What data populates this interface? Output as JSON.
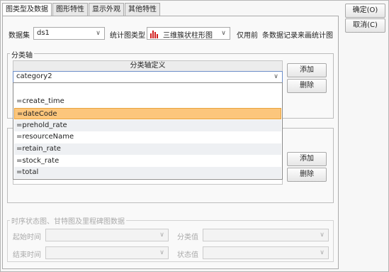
{
  "tabs": [
    "图类型及数据",
    "图形特性",
    "显示外观",
    "其他特性"
  ],
  "buttons": {
    "ok": "确定(O)",
    "cancel": "取消(C)",
    "add1": "添加",
    "delete1": "删除",
    "add2": "添加",
    "delete2": "删除"
  },
  "dataset": {
    "label": "数据集",
    "value": "ds1"
  },
  "chart_type": {
    "label": "统计图类型",
    "value": "三维簇状柱形图",
    "icon": "bar-chart-icon"
  },
  "limit": {
    "prefix": "仅用前",
    "suffix": "条数据记录来画统计图"
  },
  "category_axis": {
    "legend": "分类轴",
    "column_header": "分类轴定义",
    "selected": "category2",
    "options": [
      "=create_time",
      "=dateCode",
      "=prehold_rate",
      "=resourceName",
      "=retain_rate",
      "=stock_rate",
      "=total"
    ],
    "highlighted": "=dateCode"
  },
  "timeline_group": {
    "legend": "时序状态图、甘特图及里程碑图数据",
    "start_time": "起始时间",
    "end_time": "结束时间",
    "category_value": "分类值",
    "status_value": "状态值"
  },
  "colors": {
    "highlight": "#fcc67c",
    "highlight_border": "#e8a33d",
    "chart_icon": "#d21f1f"
  }
}
